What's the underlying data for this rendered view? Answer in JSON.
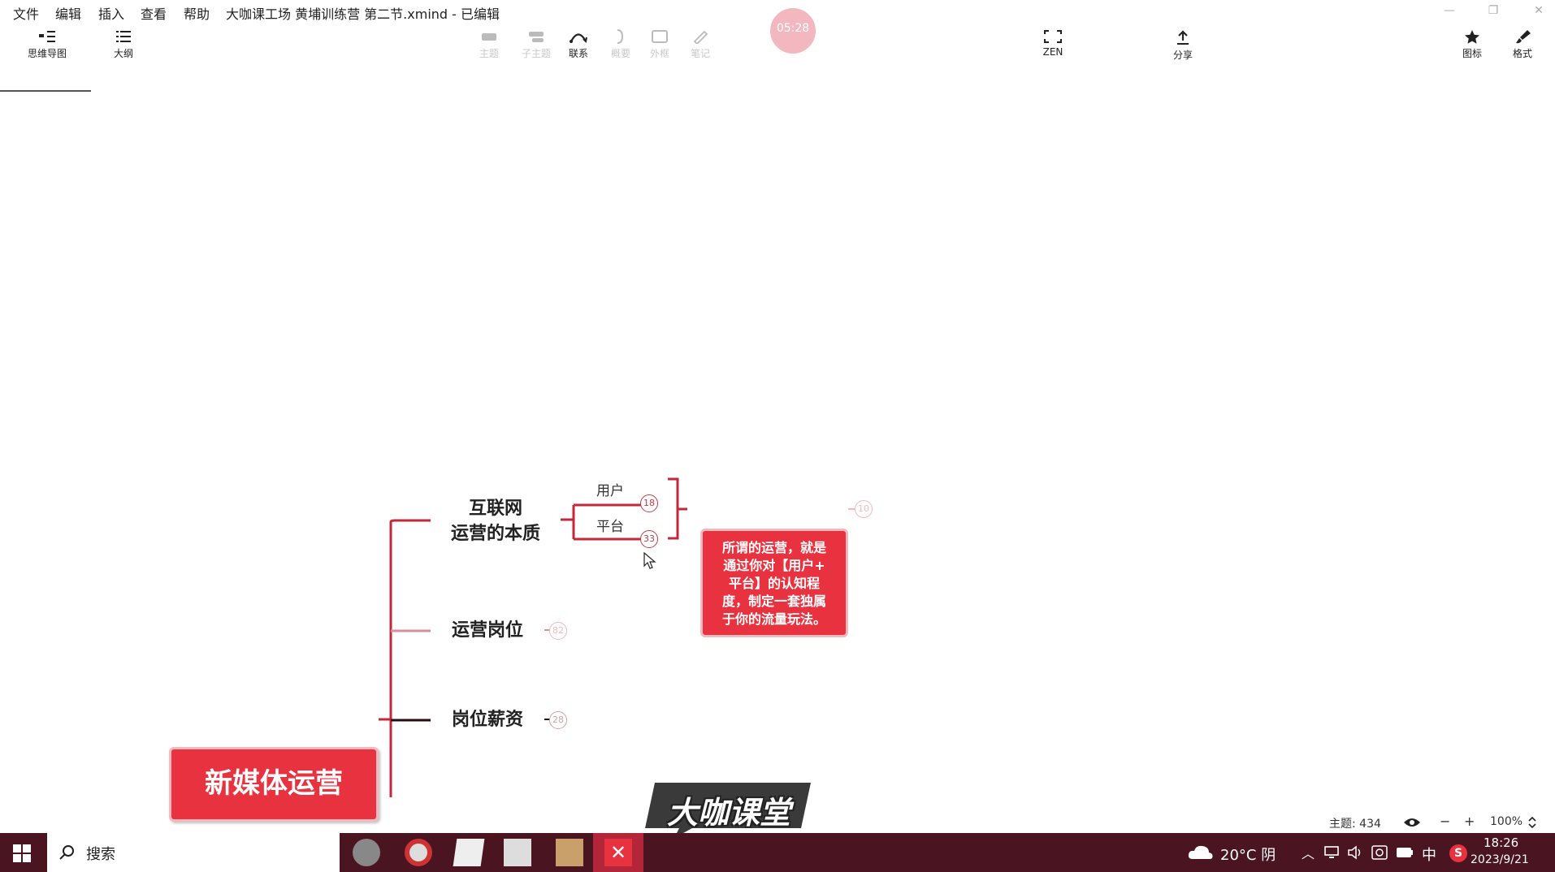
{
  "menu": {
    "items": [
      "文件",
      "编辑",
      "插入",
      "查看",
      "帮助"
    ],
    "window_title": "大咖课工场 黄埔训练营 第二节.xmind - 已编辑"
  },
  "timer": "05:28",
  "toolbar": {
    "left": [
      {
        "label": "思维导图",
        "icon": "mindmap-icon"
      },
      {
        "label": "大纲",
        "icon": "outline-icon"
      }
    ],
    "center": [
      {
        "label": "主题",
        "icon": "topic-icon"
      },
      {
        "label": "子主题",
        "icon": "subtopic-icon"
      },
      {
        "label": "联系",
        "icon": "relationship-icon"
      },
      {
        "label": "概要",
        "icon": "summary-icon"
      },
      {
        "label": "外框",
        "icon": "boundary-icon"
      },
      {
        "label": "笔记",
        "icon": "note-icon"
      }
    ],
    "zen": {
      "label": "ZEN",
      "icon": "zen-icon"
    },
    "share": {
      "label": "分享",
      "icon": "share-icon"
    },
    "right": [
      {
        "label": "图标",
        "icon": "star-icon"
      },
      {
        "label": "格式",
        "icon": "brush-icon"
      }
    ]
  },
  "mindmap": {
    "central_topic": "新媒体运营",
    "branches": [
      {
        "title_lines": [
          "互联网",
          "运营的本质"
        ]
      },
      {
        "title_lines": [
          "运营岗位"
        ],
        "count": "82"
      },
      {
        "title_lines": [
          "岗位薪资"
        ],
        "count": "28"
      }
    ],
    "leaves": [
      {
        "label": "用户",
        "count": "18"
      },
      {
        "label": "平台",
        "count": "33"
      }
    ],
    "callout": {
      "lines": [
        "所谓的运营，就是",
        "通过你对【用户+",
        "平台】的认知程",
        "度，制定一套独属",
        "于你的流量玩法。"
      ],
      "count": "10"
    }
  },
  "watermark": "大咖课堂",
  "statusbar": {
    "topics_label": "主题: 434",
    "zoom": "100%",
    "zoom_out": "−",
    "zoom_in": "+"
  },
  "taskbar": {
    "search": "搜索",
    "weather": "20°C 阴",
    "ime": "中",
    "time": "18:26",
    "date": "2023/9/21"
  },
  "colors": {
    "accent": "#e8323f",
    "connector": "#c2283a",
    "taskbar": "#4a1420"
  }
}
